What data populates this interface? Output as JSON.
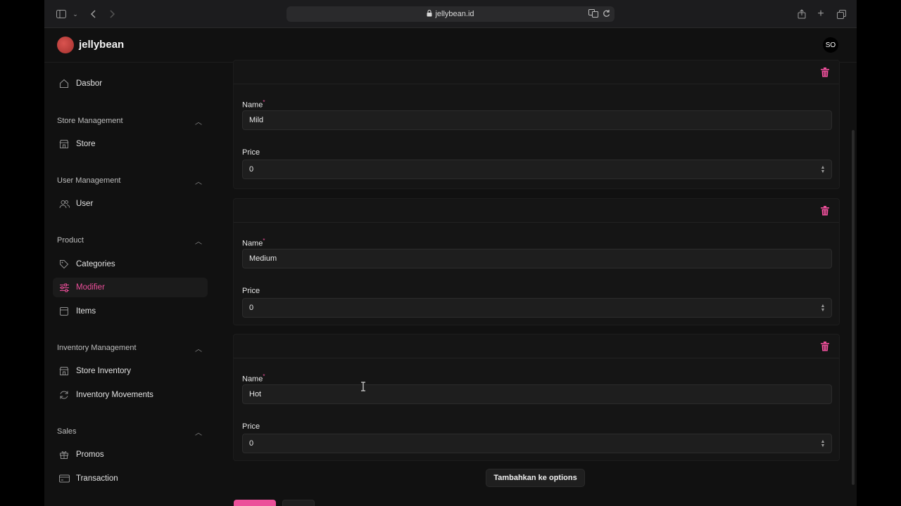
{
  "browser": {
    "url": "jellybean.id"
  },
  "header": {
    "brand": "jellybean",
    "avatar_initials": "SO"
  },
  "sidebar": {
    "dashboard": "Dasbor",
    "sections": [
      {
        "title": "Store Management",
        "items": [
          "Store"
        ]
      },
      {
        "title": "User Management",
        "items": [
          "User"
        ]
      },
      {
        "title": "Product",
        "items": [
          "Categories",
          "Modifier",
          "Items"
        ]
      },
      {
        "title": "Inventory Management",
        "items": [
          "Store Inventory",
          "Inventory Movements"
        ]
      },
      {
        "title": "Sales",
        "items": [
          "Promos",
          "Transaction"
        ]
      }
    ],
    "active_item": "Modifier"
  },
  "form": {
    "name_label": "Name",
    "required_mark": "*",
    "price_label": "Price",
    "options": [
      {
        "name": "Mild",
        "price": "0"
      },
      {
        "name": "Medium",
        "price": "0"
      },
      {
        "name": "Hot",
        "price": "0"
      }
    ],
    "add_button": "Tambahkan ke options"
  },
  "colors": {
    "accent": "#ec4f9a",
    "background": "#111111",
    "card": "#151515"
  }
}
